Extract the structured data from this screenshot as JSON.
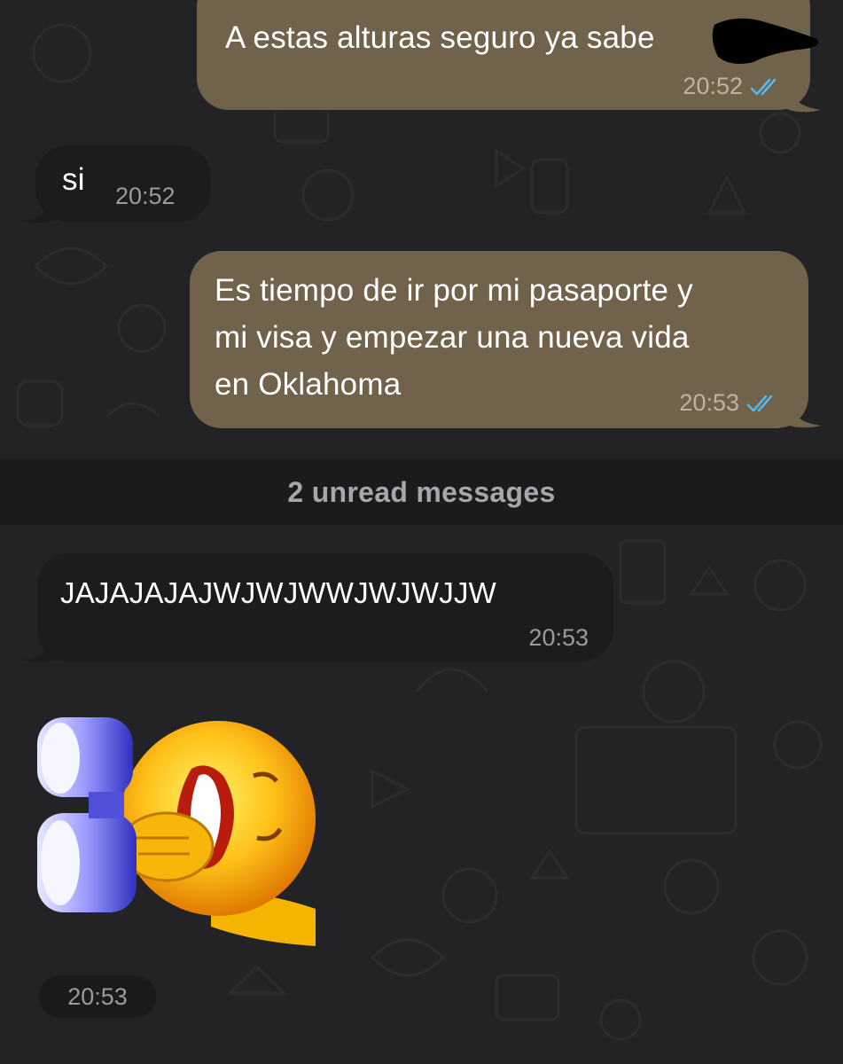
{
  "messages": [
    {
      "direction": "outgoing",
      "text": "A estas alturas seguro ya sabe",
      "time": "20:52",
      "status": "read"
    },
    {
      "direction": "incoming",
      "text": "si",
      "time": "20:52"
    },
    {
      "direction": "outgoing",
      "lines": [
        "Es tiempo de ir por mi pasaporte y",
        "mi visa y empezar una nueva vida",
        "en Oklahoma"
      ],
      "time": "20:53",
      "status": "read"
    },
    {
      "direction": "incoming",
      "text": "JAJAJAJAJWJWJWWJWJWJJW",
      "time": "20:53"
    },
    {
      "direction": "incoming",
      "type": "sticker",
      "sticker_icon": "laughing-emoji-with-binoculars-sticker",
      "time": "20:53"
    }
  ],
  "unread_banner": "2 unread messages",
  "colors": {
    "background": "#232325",
    "outgoing_bubble": "#71624b",
    "incoming_bubble": "#1c1c1e",
    "read_ticks": "#53b9f2"
  }
}
